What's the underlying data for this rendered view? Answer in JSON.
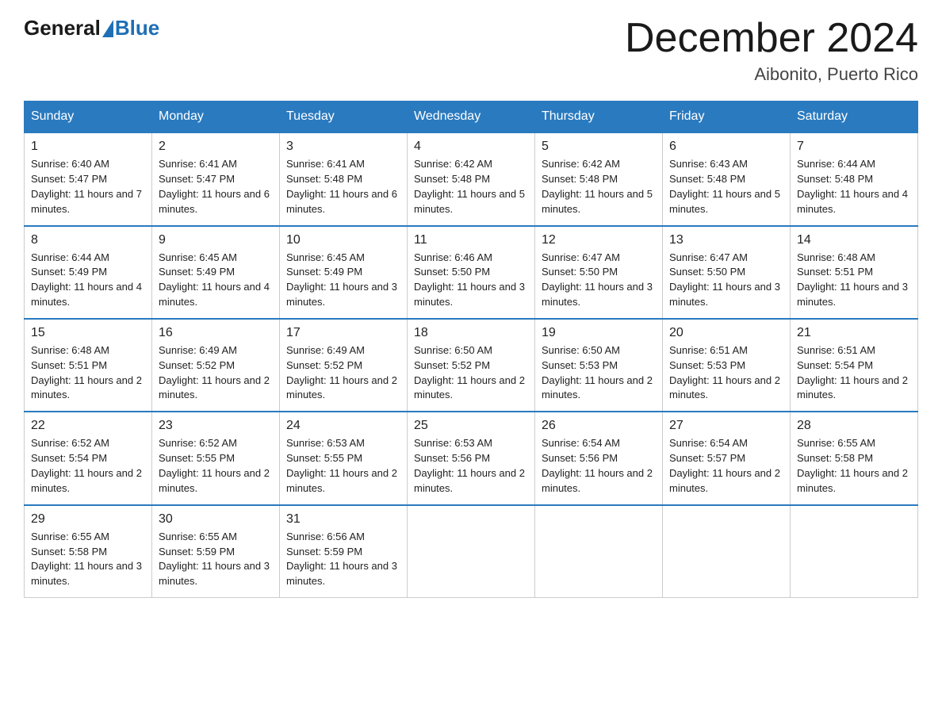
{
  "header": {
    "logo_general": "General",
    "logo_blue": "Blue",
    "month_title": "December 2024",
    "location": "Aibonito, Puerto Rico"
  },
  "days_of_week": [
    "Sunday",
    "Monday",
    "Tuesday",
    "Wednesday",
    "Thursday",
    "Friday",
    "Saturday"
  ],
  "weeks": [
    [
      {
        "day": "1",
        "sunrise": "6:40 AM",
        "sunset": "5:47 PM",
        "daylight": "11 hours and 7 minutes."
      },
      {
        "day": "2",
        "sunrise": "6:41 AM",
        "sunset": "5:47 PM",
        "daylight": "11 hours and 6 minutes."
      },
      {
        "day": "3",
        "sunrise": "6:41 AM",
        "sunset": "5:48 PM",
        "daylight": "11 hours and 6 minutes."
      },
      {
        "day": "4",
        "sunrise": "6:42 AM",
        "sunset": "5:48 PM",
        "daylight": "11 hours and 5 minutes."
      },
      {
        "day": "5",
        "sunrise": "6:42 AM",
        "sunset": "5:48 PM",
        "daylight": "11 hours and 5 minutes."
      },
      {
        "day": "6",
        "sunrise": "6:43 AM",
        "sunset": "5:48 PM",
        "daylight": "11 hours and 5 minutes."
      },
      {
        "day": "7",
        "sunrise": "6:44 AM",
        "sunset": "5:48 PM",
        "daylight": "11 hours and 4 minutes."
      }
    ],
    [
      {
        "day": "8",
        "sunrise": "6:44 AM",
        "sunset": "5:49 PM",
        "daylight": "11 hours and 4 minutes."
      },
      {
        "day": "9",
        "sunrise": "6:45 AM",
        "sunset": "5:49 PM",
        "daylight": "11 hours and 4 minutes."
      },
      {
        "day": "10",
        "sunrise": "6:45 AM",
        "sunset": "5:49 PM",
        "daylight": "11 hours and 3 minutes."
      },
      {
        "day": "11",
        "sunrise": "6:46 AM",
        "sunset": "5:50 PM",
        "daylight": "11 hours and 3 minutes."
      },
      {
        "day": "12",
        "sunrise": "6:47 AM",
        "sunset": "5:50 PM",
        "daylight": "11 hours and 3 minutes."
      },
      {
        "day": "13",
        "sunrise": "6:47 AM",
        "sunset": "5:50 PM",
        "daylight": "11 hours and 3 minutes."
      },
      {
        "day": "14",
        "sunrise": "6:48 AM",
        "sunset": "5:51 PM",
        "daylight": "11 hours and 3 minutes."
      }
    ],
    [
      {
        "day": "15",
        "sunrise": "6:48 AM",
        "sunset": "5:51 PM",
        "daylight": "11 hours and 2 minutes."
      },
      {
        "day": "16",
        "sunrise": "6:49 AM",
        "sunset": "5:52 PM",
        "daylight": "11 hours and 2 minutes."
      },
      {
        "day": "17",
        "sunrise": "6:49 AM",
        "sunset": "5:52 PM",
        "daylight": "11 hours and 2 minutes."
      },
      {
        "day": "18",
        "sunrise": "6:50 AM",
        "sunset": "5:52 PM",
        "daylight": "11 hours and 2 minutes."
      },
      {
        "day": "19",
        "sunrise": "6:50 AM",
        "sunset": "5:53 PM",
        "daylight": "11 hours and 2 minutes."
      },
      {
        "day": "20",
        "sunrise": "6:51 AM",
        "sunset": "5:53 PM",
        "daylight": "11 hours and 2 minutes."
      },
      {
        "day": "21",
        "sunrise": "6:51 AM",
        "sunset": "5:54 PM",
        "daylight": "11 hours and 2 minutes."
      }
    ],
    [
      {
        "day": "22",
        "sunrise": "6:52 AM",
        "sunset": "5:54 PM",
        "daylight": "11 hours and 2 minutes."
      },
      {
        "day": "23",
        "sunrise": "6:52 AM",
        "sunset": "5:55 PM",
        "daylight": "11 hours and 2 minutes."
      },
      {
        "day": "24",
        "sunrise": "6:53 AM",
        "sunset": "5:55 PM",
        "daylight": "11 hours and 2 minutes."
      },
      {
        "day": "25",
        "sunrise": "6:53 AM",
        "sunset": "5:56 PM",
        "daylight": "11 hours and 2 minutes."
      },
      {
        "day": "26",
        "sunrise": "6:54 AM",
        "sunset": "5:56 PM",
        "daylight": "11 hours and 2 minutes."
      },
      {
        "day": "27",
        "sunrise": "6:54 AM",
        "sunset": "5:57 PM",
        "daylight": "11 hours and 2 minutes."
      },
      {
        "day": "28",
        "sunrise": "6:55 AM",
        "sunset": "5:58 PM",
        "daylight": "11 hours and 2 minutes."
      }
    ],
    [
      {
        "day": "29",
        "sunrise": "6:55 AM",
        "sunset": "5:58 PM",
        "daylight": "11 hours and 3 minutes."
      },
      {
        "day": "30",
        "sunrise": "6:55 AM",
        "sunset": "5:59 PM",
        "daylight": "11 hours and 3 minutes."
      },
      {
        "day": "31",
        "sunrise": "6:56 AM",
        "sunset": "5:59 PM",
        "daylight": "11 hours and 3 minutes."
      },
      null,
      null,
      null,
      null
    ]
  ]
}
